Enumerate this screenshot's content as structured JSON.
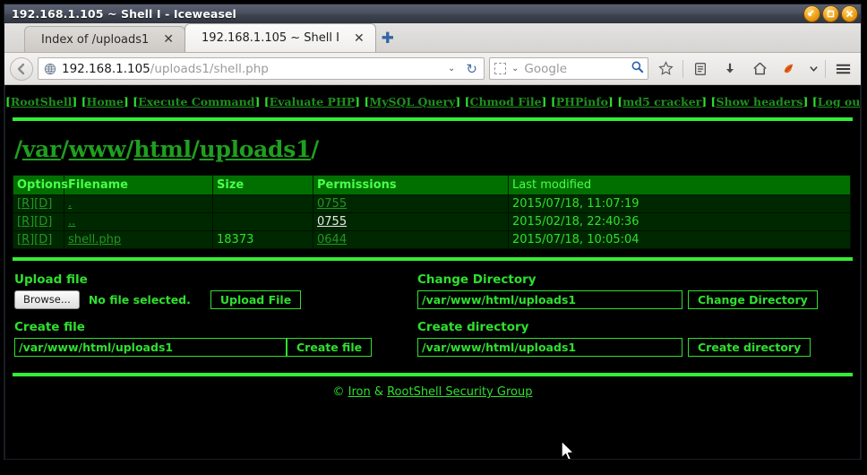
{
  "window": {
    "title": "192.168.1.105 ~ Shell I - Iceweasel",
    "controls": [
      {
        "name": "minimize-button",
        "glyph": "minimize"
      },
      {
        "name": "maximize-button",
        "glyph": "maximize"
      },
      {
        "name": "close-button",
        "glyph": "close"
      }
    ]
  },
  "tabs": [
    {
      "label": "Index of /uploads1",
      "active": false,
      "close": "✕"
    },
    {
      "label": "192.168.1.105 ~ Shell I",
      "active": true,
      "close": "✕"
    }
  ],
  "newtab_glyph": "✚",
  "toolbar": {
    "back_glyph": "←",
    "url_host": "192.168.1.105",
    "url_path": "/uploads1/shell.php",
    "url_dropdown_glyph": "⌄",
    "reload_glyph": "↻",
    "search_placeholder": "Google",
    "search_icon": "search-icon",
    "icons": [
      {
        "name": "bookmark-star-icon"
      },
      {
        "name": "library-icon"
      },
      {
        "name": "downloads-icon"
      },
      {
        "name": "home-icon"
      },
      {
        "name": "iceweasel-logo-icon"
      },
      {
        "name": "toolbar-dropdown-icon"
      },
      {
        "name": "hamburger-menu-icon"
      }
    ]
  },
  "shell": {
    "nav_links": [
      "RootShell",
      "Home",
      "Execute Command",
      "Evaluate PHP",
      "MySQL Query",
      "Chmod File",
      "PHPinfo",
      "md5 cracker",
      "Show headers",
      "Log out"
    ],
    "breadcrumb": {
      "parts": [
        "var",
        "www",
        "html",
        "uploads1"
      ],
      "sep": "/"
    },
    "table": {
      "headers": [
        "Options",
        "Filename",
        "Size",
        "Permissions",
        "Last modified"
      ],
      "rows": [
        {
          "options": "[R][D]",
          "filename": ".",
          "size": "",
          "permissions": "0755",
          "perm_bright": false,
          "modified": "2015/07/18, 11:07:19"
        },
        {
          "options": "[R][D]",
          "filename": "..",
          "size": "",
          "permissions": "0755",
          "perm_bright": true,
          "modified": "2015/02/18, 22:40:36"
        },
        {
          "options": "[R][D]",
          "filename": "shell.php",
          "size": "18373",
          "permissions": "0644",
          "perm_bright": false,
          "modified": "2015/07/18, 10:05:04"
        }
      ]
    },
    "upload": {
      "label": "Upload file",
      "browse_label": "Browse...",
      "file_status": "No file selected.",
      "submit_label": "Upload File"
    },
    "change_directory": {
      "label": "Change Directory",
      "value": "/var/www/html/uploads1",
      "submit_label": "Change Directory"
    },
    "create_file": {
      "label": "Create file",
      "value": "/var/www/html/uploads1",
      "submit_label": "Create file"
    },
    "create_directory": {
      "label": "Create directory",
      "value": "/var/www/html/uploads1",
      "submit_label": "Create directory"
    },
    "footer": {
      "copyright": "©",
      "author": "Iron",
      "amp": "&",
      "group": "RootShell Security Group"
    }
  },
  "colors": {
    "bright_green": "#33ee33",
    "link_green": "#1f9f1f",
    "header_green": "#006f00",
    "row_bg": "#002800",
    "page_bg": "#000000"
  }
}
